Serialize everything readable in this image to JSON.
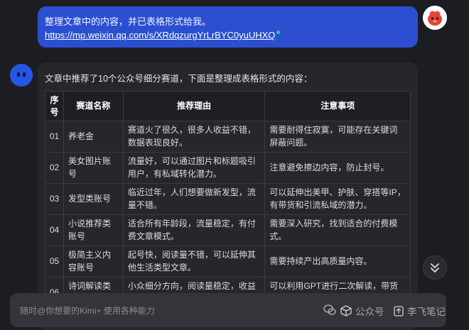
{
  "user_message": {
    "text": "整理文章中的内容，并已表格形式给我。",
    "link": "https://mp.weixin.qq.com/s/XRdqzurgYrLrBYC0yuUHXQ"
  },
  "bot_message": {
    "intro": "文章中推荐了10个公众号细分赛道，下面是整理成表格形式的内容："
  },
  "table": {
    "headers": [
      "序号",
      "赛道名称",
      "推荐理由",
      "注意事项"
    ],
    "rows": [
      [
        "01",
        "养老金",
        "赛道火了很久，很多人收益不错，数据表现良好。",
        "需要耐得住寂寞，可能存在关键词屏蔽问题。"
      ],
      [
        "02",
        "美女图片账号",
        "流量好，可以通过图片和标题吸引用户，有私域转化潜力。",
        "注意避免擦边内容，防止封号。"
      ],
      [
        "03",
        "发型类账号",
        "临近过年，人们想要做新发型，流量不错。",
        "可以延伸出美甲、护肤、穿搭等IP，有带货和引流私域的潜力。"
      ],
      [
        "04",
        "小说推荐类账号",
        "适合所有年龄段，流量稳定，有付费文章模式。",
        "需要深入研究，找到适合的付费模式。"
      ],
      [
        "05",
        "极简主义内容账号",
        "起号快，阅读量不错，可以延伸其他生活类型文章。",
        "需要持续产出高质量内容。"
      ],
      [
        "06",
        "诗词解读类账号",
        "小众细分方向，阅读量稳定，收益不错。",
        "可以利用GPT进行二次解读，带货相关书籍增加变现途径。"
      ]
    ]
  },
  "input": {
    "placeholder": "随时@你想要的Kimi+ 使用各种能力"
  },
  "watermark": {
    "source": "公众号",
    "author": "李飞笔记"
  }
}
